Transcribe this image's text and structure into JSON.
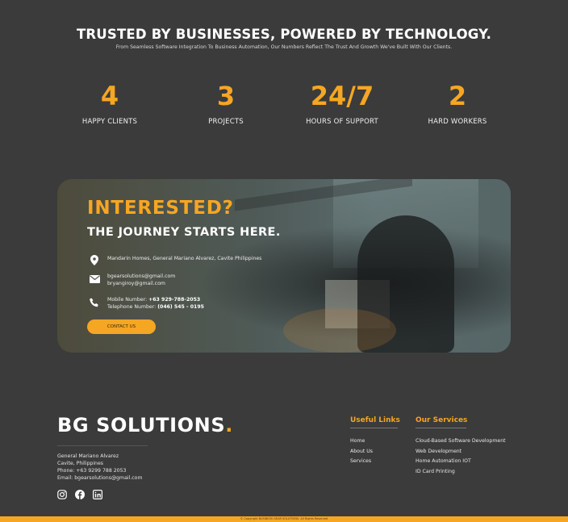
{
  "trusted": {
    "title": "TRUSTED BY BUSINESSES, POWERED BY TECHNOLOGY.",
    "subtitle": "From Seamless Software Integration To Business Automation, Our Numbers Reflect The Trust And Growth We've Built With Our Clients."
  },
  "stats": [
    {
      "value": "4",
      "label": "HAPPY CLIENTS"
    },
    {
      "value": "3",
      "label": "PROJECTS"
    },
    {
      "value": "24/7",
      "label": "HOURS OF SUPPORT"
    },
    {
      "value": "2",
      "label": "HARD WORKERS"
    }
  ],
  "interested": {
    "heading": "INTERESTED?",
    "subheading": "THE JOURNEY STARTS HERE.",
    "address": "Mandarin Homes, General Mariano Alvarez, Cavite Philippines",
    "email1": "bgearsolutions@gmail.com",
    "email2": "bryangiroy@gmail.com",
    "mobile_label": "Mobile Number: ",
    "mobile_value": "+63 929-788-2053",
    "telephone_label": "Telephone Number: ",
    "telephone_value": "(046) 545 - 0195",
    "button_label": "CONTACT US"
  },
  "footer": {
    "brand": "BG SOLUTIONS",
    "brand_dot": ".",
    "info": [
      "General Mariano Alvarez",
      "Cavite, Philippines",
      "Phone: +63 9299 788 2053",
      "Email: bgearsolutions@gmail.com"
    ],
    "social_icons": [
      "instagram-icon",
      "facebook-icon",
      "linkedin-icon"
    ],
    "useful_links_title": "Useful Links",
    "useful_links": [
      "Home",
      "About Us",
      "Services"
    ],
    "services_title": "Our Services",
    "services": [
      "Cloud-Based Software Development",
      "Web Development",
      "Home Automation IOT",
      "ID Card Printing"
    ],
    "copyright": "© Copyright BUSINESS GEAR SOLUTIONS. All Rights Reserved"
  },
  "colors": {
    "accent": "#f5a623",
    "background": "#3b3b3b"
  }
}
